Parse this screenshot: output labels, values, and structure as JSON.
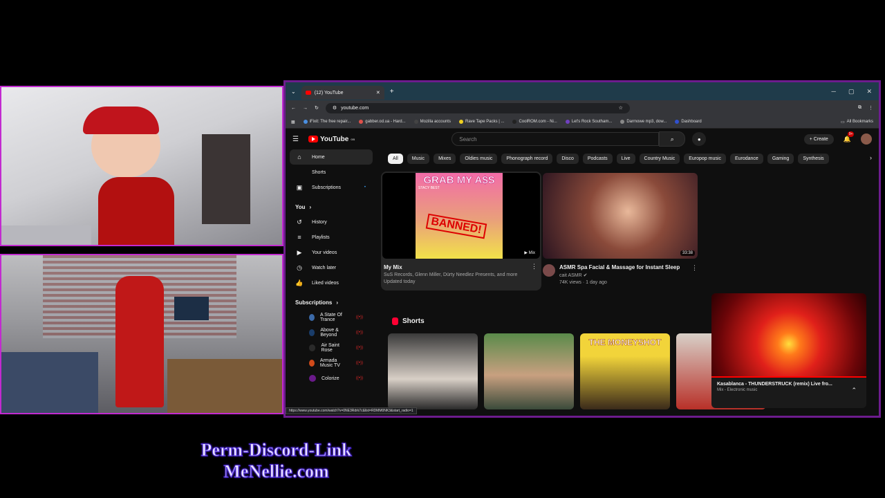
{
  "browser": {
    "tab_title": "(12) YouTube",
    "url": "youtube.com",
    "bookmarks": [
      "iFixit: The free repair...",
      "gabber.od.ua - Hard...",
      "Mozilla accounts",
      "Rave Tape Packs | ...",
      "CoolROM.com - Ni...",
      "Let's Rock Southam...",
      "Darmowe mp3, dow...",
      "Dashboard"
    ],
    "all_bookmarks_label": "All Bookmarks",
    "status_url": "https://www.youtube.com/watch?v=0NE3Rdrk7c&list=RDMM0NK3&start_radio=1"
  },
  "youtube": {
    "logo_text": "YouTube",
    "logo_region": "GB",
    "search_placeholder": "Search",
    "create_label": "Create",
    "notification_count": "9+",
    "sidebar": {
      "main": [
        {
          "label": "Home",
          "icon": "home-icon"
        },
        {
          "label": "Shorts",
          "icon": "shorts-icon"
        },
        {
          "label": "Subscriptions",
          "icon": "subscriptions-icon"
        }
      ],
      "you_label": "You",
      "you_items": [
        {
          "label": "History",
          "icon": "history-icon"
        },
        {
          "label": "Playlists",
          "icon": "playlists-icon"
        },
        {
          "label": "Your videos",
          "icon": "your-videos-icon"
        },
        {
          "label": "Watch later",
          "icon": "watch-later-icon"
        },
        {
          "label": "Liked videos",
          "icon": "liked-icon"
        }
      ],
      "subscriptions_label": "Subscriptions",
      "subscriptions": [
        "A State Of Trance",
        "Above & Beyond",
        "Air Saint Rose",
        "Armada Music TV",
        "Colorize"
      ]
    },
    "chips": [
      "All",
      "Music",
      "Mixes",
      "Oldies music",
      "Phonograph record",
      "Disco",
      "Podcasts",
      "Live",
      "Country Music",
      "Europop music",
      "Eurodance",
      "Gaming",
      "Synthesis"
    ],
    "videos": [
      {
        "title": "My Mix",
        "meta1": "SuS Records, Glenn Miller, Dürty Needlez Presents, and more",
        "meta2": "Updated today",
        "badge": "Mix",
        "thumb_text": "GRAB MY A$S",
        "thumb_artist": "STACY BEST",
        "thumb_stamp": "BANNED!"
      },
      {
        "title": "ASMR Spa Facial & Massage for Instant Sleep",
        "channel": "cait ASMR",
        "stats": "74K views · 1 day ago",
        "duration": "33:38"
      }
    ],
    "shorts_label": "Shorts",
    "shorts": [
      {
        "caption": ""
      },
      {
        "caption": ""
      },
      {
        "caption": "THE MONEYSHOT"
      },
      {
        "caption": ""
      }
    ],
    "miniplayer": {
      "title": "Kasablanca - THUNDERSTRUCK (remix) Live fro...",
      "subtitle": "Mix - Electronic music"
    }
  },
  "overlay": {
    "line1": "Perm-Discord-Link",
    "line2": "MeNellie.com"
  }
}
